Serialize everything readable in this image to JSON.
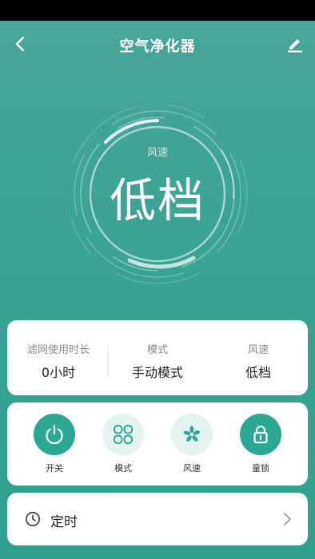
{
  "header": {
    "title": "空气净化器",
    "back_icon": "chevron-left-icon",
    "edit_icon": "pencil-icon"
  },
  "dial": {
    "label": "风速",
    "value": "低档"
  },
  "info": [
    {
      "label": "滤网使用时长",
      "value": "0小时"
    },
    {
      "label": "模式",
      "value": "手动模式"
    },
    {
      "label": "风速",
      "value": "低档"
    }
  ],
  "controls": [
    {
      "label": "开关",
      "icon": "power-icon",
      "active": true
    },
    {
      "label": "模式",
      "icon": "grid-mode-icon",
      "active": false
    },
    {
      "label": "风速",
      "icon": "fan-icon",
      "active": false
    },
    {
      "label": "童锁",
      "icon": "lock-icon",
      "active": true
    }
  ],
  "timer": {
    "label": "定时",
    "icon": "clock-icon"
  },
  "colors": {
    "accent": "#2aa891",
    "accent_light": "#e3f4f1",
    "background": "#3aa392"
  }
}
